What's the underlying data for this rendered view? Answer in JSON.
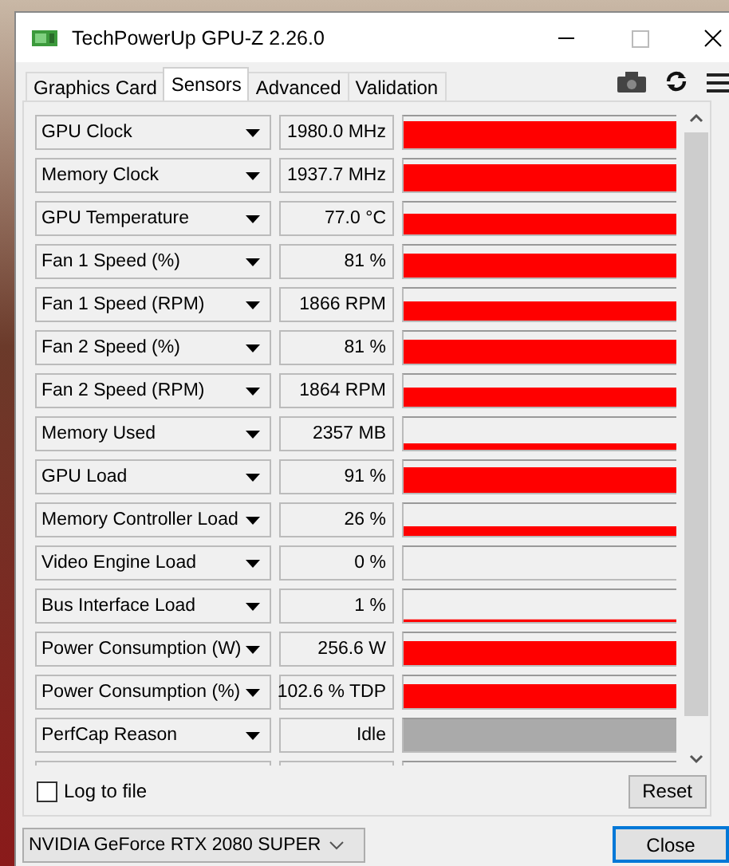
{
  "window": {
    "title": "TechPowerUp GPU-Z 2.26.0"
  },
  "tabs": [
    {
      "label": "Graphics Card",
      "selected": false
    },
    {
      "label": "Sensors",
      "selected": true
    },
    {
      "label": "Advanced",
      "selected": false
    },
    {
      "label": "Validation",
      "selected": false
    }
  ],
  "sensors": [
    {
      "name": "GPU Clock",
      "value": "1980.0 MHz",
      "color": "#ff0000"
    },
    {
      "name": "Memory Clock",
      "value": "1937.7 MHz",
      "color": "#ff0000"
    },
    {
      "name": "GPU Temperature",
      "value": "77.0 °C",
      "color": "#ff0000"
    },
    {
      "name": "Fan 1 Speed (%)",
      "value": "81 %",
      "color": "#ff0000"
    },
    {
      "name": "Fan 1 Speed (RPM)",
      "value": "1866 RPM",
      "color": "#ff0000"
    },
    {
      "name": "Fan 2 Speed (%)",
      "value": "81 %",
      "color": "#ff0000"
    },
    {
      "name": "Fan 2 Speed (RPM)",
      "value": "1864 RPM",
      "color": "#ff0000"
    },
    {
      "name": "Memory Used",
      "value": "2357 MB",
      "color": "#ff0000"
    },
    {
      "name": "GPU Load",
      "value": "91 %",
      "color": "#ff0000"
    },
    {
      "name": "Memory Controller Load",
      "value": "26 %",
      "color": "#ff0000"
    },
    {
      "name": "Video Engine Load",
      "value": "0 %"
    },
    {
      "name": "Bus Interface Load",
      "value": "1 %",
      "color": "#ff0000"
    },
    {
      "name": "Power Consumption (W)",
      "value": "256.6 W",
      "color": "#ff0000"
    },
    {
      "name": "Power Consumption (%)",
      "value": "102.6 % TDP",
      "color": "#ff0000"
    },
    {
      "name": "PerfCap Reason",
      "value": "Idle",
      "color": "#aaaaaa"
    }
  ],
  "log_to_file": {
    "label": "Log to file",
    "checked": false
  },
  "reset_button": "Reset",
  "gpu_select": {
    "value": "NVIDIA GeForce RTX 2080 SUPER"
  },
  "close_button": "Close"
}
